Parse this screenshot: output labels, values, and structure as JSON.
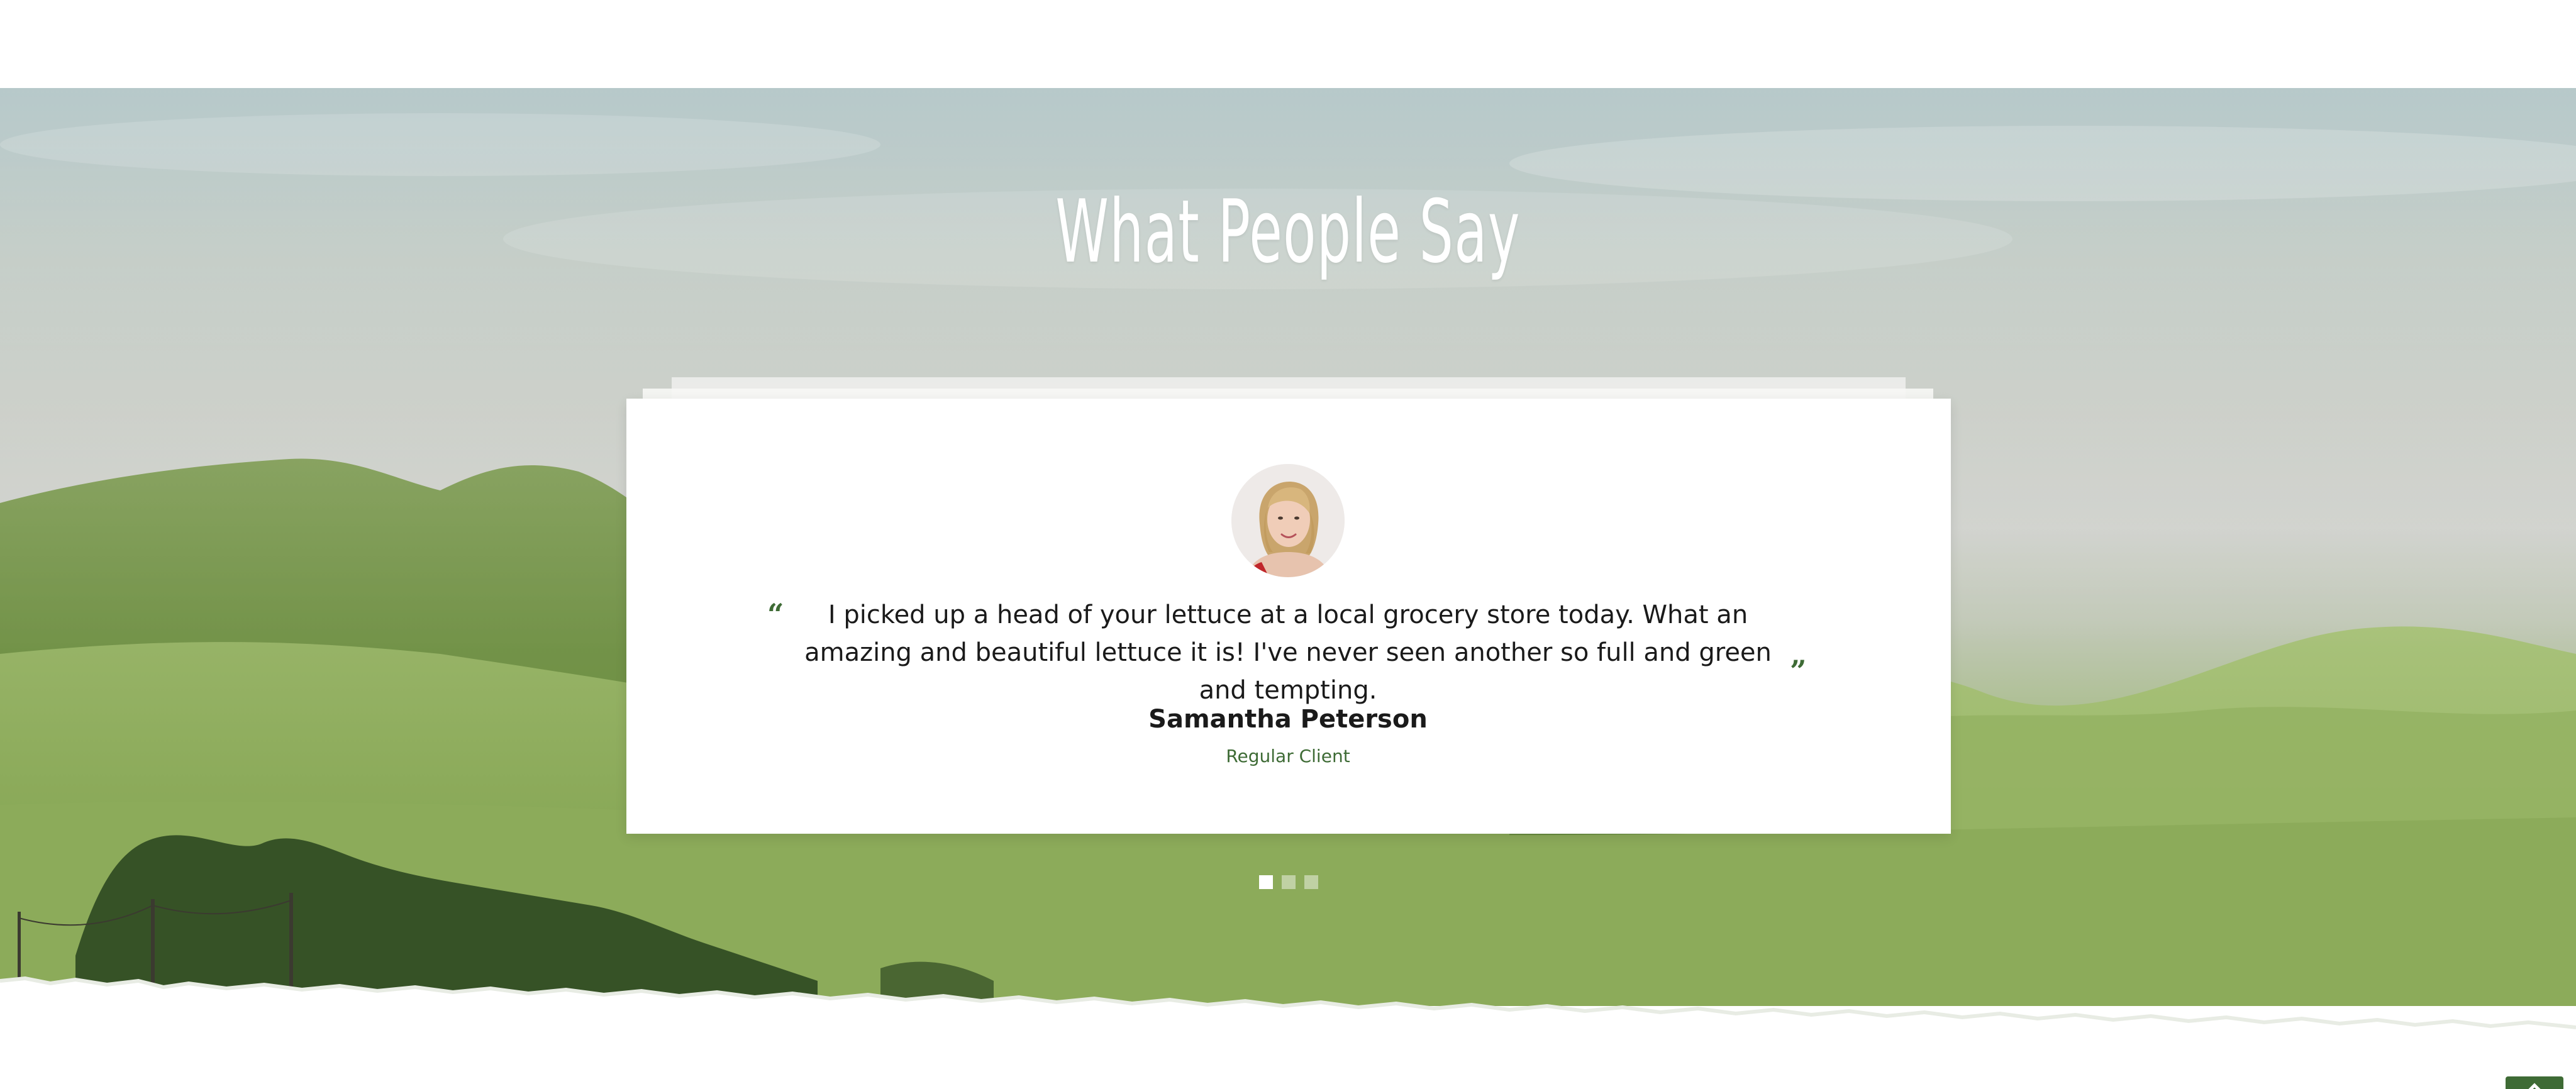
{
  "section": {
    "title": "What People Say"
  },
  "testimonial": {
    "quote": "I picked up a head of your lettuce at a local grocery store today. What an amazing and beautiful lettuce it is! I've never seen another so full and green and tempting.",
    "name": "Samantha Peterson",
    "role": "Regular Client",
    "open_quote": "“",
    "close_quote": "”"
  },
  "slider": {
    "slide_count": 3,
    "active_slide": 1
  },
  "colors": {
    "accent_green": "#3e6b35",
    "card_background": "#ffffff",
    "title_color": "#ffffff"
  },
  "icons": {
    "background": "green-hills-landscape-image",
    "avatar": "client-portrait",
    "scroll_top": "chevron-up-icon"
  }
}
